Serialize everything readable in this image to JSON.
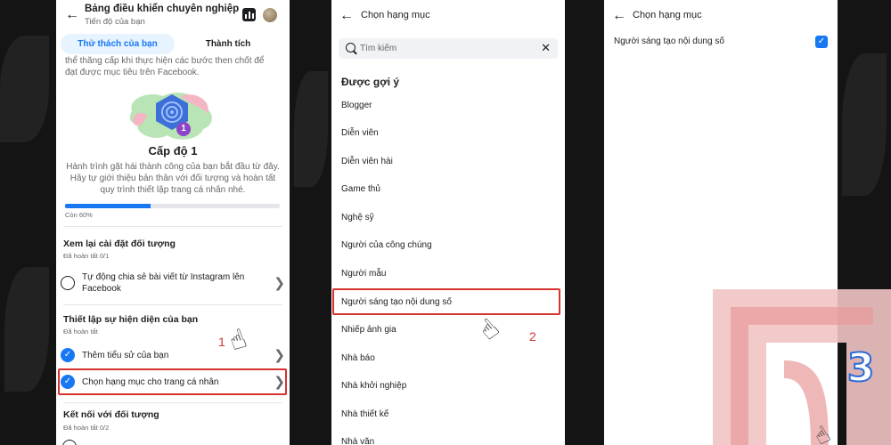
{
  "panel1": {
    "title": "Bảng điều khiển chuyên nghiệp",
    "subtitle": "Tiến độ của bạn",
    "tabs": [
      {
        "label": "Thử thách của bạn",
        "active": true
      },
      {
        "label": "Thành tích",
        "active": false
      }
    ],
    "intro_text": "thể thăng cấp khi thực hiện các bước then chốt để đạt được mục tiêu trên Facebook.",
    "level_title": "Cấp độ 1",
    "level_badge": "1",
    "level_description": "Hành trình gặt hái thành công của bạn bắt đầu từ đây. Hãy tự giới thiệu bản thân với đối tượng và hoàn tất quy trình thiết lập trang cá nhân nhé.",
    "progress_label": "Còn 60%",
    "progress_fraction": 0.4,
    "sections": [
      {
        "title": "Xem lại cài đặt đối tượng",
        "status": "Đã hoàn tất 0/1",
        "tasks": [
          {
            "label": "Tự động chia sẻ bài viết từ Instagram lên Facebook",
            "done": false
          }
        ]
      },
      {
        "title": "Thiết lập sự hiện diện của bạn",
        "status": "Đã hoàn tất",
        "tasks": [
          {
            "label": "Thêm tiểu sử của bạn",
            "done": true
          },
          {
            "label": "Chọn hạng mục cho trang cá nhân",
            "done": true
          }
        ]
      },
      {
        "title": "Kết nối với đối tượng",
        "status": "Đã hoàn tất 0/2",
        "tasks": []
      }
    ],
    "step_number": "1"
  },
  "panel2": {
    "header_title": "Chọn hạng mục",
    "search_placeholder": "Tìm kiếm",
    "suggested_title": "Được gợi ý",
    "categories": [
      "Blogger",
      "Diễn viên",
      "Diễn viên hài",
      "Game thủ",
      "Nghệ sỹ",
      "Người của công chúng",
      "Người mẫu",
      "Người sáng tạo nội dung số",
      "Nhiếp ảnh gia",
      "Nhà báo",
      "Nhà khởi nghiệp",
      "Nhà thiết kế",
      "Nhà văn"
    ],
    "highlighted_category": "Người sáng tạo nội dung số",
    "step_number": "2"
  },
  "panel3": {
    "header_title": "Chọn hạng mục",
    "selected_item": "Người sáng tạo nội dung số",
    "checked": true,
    "step_number": "3"
  },
  "colors": {
    "accent": "#1877f2",
    "highlight": "#d6322f",
    "background": "#141414"
  },
  "icons": [
    "back-arrow-icon",
    "bar-chart-icon",
    "search-icon",
    "clear-icon",
    "checkmark-icon",
    "chevron-right-icon",
    "pointing-hand-icon"
  ]
}
